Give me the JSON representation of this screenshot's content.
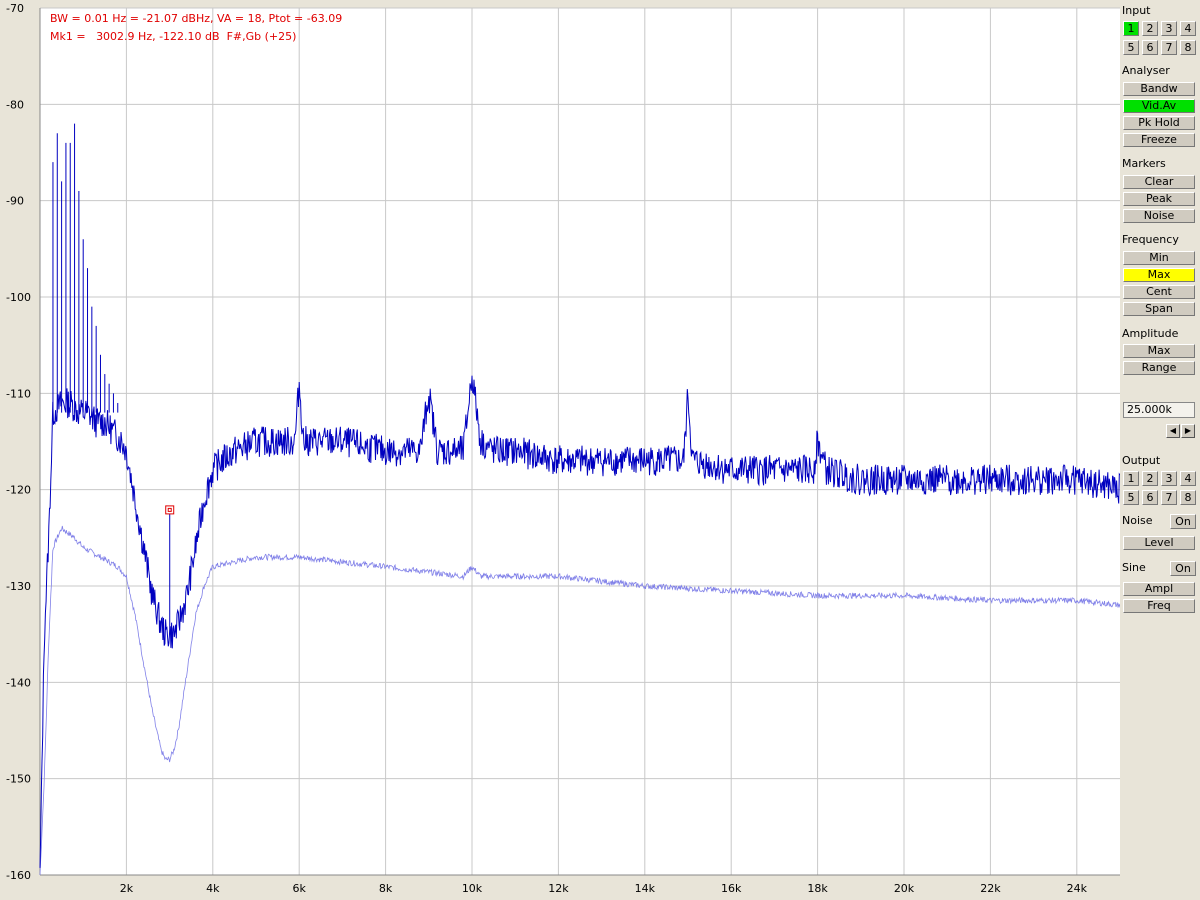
{
  "readout": {
    "line1": "BW = 0.01 Hz = -21.07 dBHz, VA = 18, Ptot = -63.09",
    "line2": "Mk1 =   3002.9 Hz, -122.10 dB  F#,Gb (+25)"
  },
  "colors": {
    "plot_bg": "#ffffff",
    "grid": "#c8c8c8",
    "trace_main": "#0000c0",
    "trace_secondary": "#8080e8",
    "marker": "#e00000",
    "active_green": "#00e000",
    "active_yellow": "#ffff00",
    "panel_bg": "#e8e4d8"
  },
  "panel": {
    "input": {
      "label": "Input",
      "channels": [
        "1",
        "2",
        "3",
        "4",
        "5",
        "6",
        "7",
        "8"
      ],
      "active": "1"
    },
    "analyser": {
      "label": "Analyser",
      "buttons": [
        {
          "label": "Bandw",
          "state": "off"
        },
        {
          "label": "Vid.Av",
          "state": "green"
        },
        {
          "label": "Pk Hold",
          "state": "off"
        },
        {
          "label": "Freeze",
          "state": "off"
        }
      ]
    },
    "markers": {
      "label": "Markers",
      "buttons": [
        {
          "label": "Clear",
          "state": "off"
        },
        {
          "label": "Peak",
          "state": "off"
        },
        {
          "label": "Noise",
          "state": "off"
        }
      ]
    },
    "frequency": {
      "label": "Frequency",
      "buttons": [
        {
          "label": "Min",
          "state": "off"
        },
        {
          "label": "Max",
          "state": "yellow"
        },
        {
          "label": "Cent",
          "state": "off"
        },
        {
          "label": "Span",
          "state": "off"
        }
      ]
    },
    "amplitude": {
      "label": "Amplitude",
      "buttons": [
        {
          "label": "Max",
          "state": "off"
        },
        {
          "label": "Range",
          "state": "off"
        }
      ]
    },
    "value_field": "25.000k",
    "arrow_left_icon": "triangle-left-icon",
    "arrow_right_icon": "triangle-right-icon",
    "output": {
      "label": "Output",
      "channels": [
        "1",
        "2",
        "3",
        "4",
        "5",
        "6",
        "7",
        "8"
      ],
      "active": ""
    },
    "noise": {
      "label": "Noise",
      "toggle": "On",
      "button": "Level"
    },
    "sine": {
      "label": "Sine",
      "toggle": "On",
      "buttons": [
        "Ampl",
        "Freq"
      ]
    }
  },
  "chart_data": {
    "type": "line",
    "title": "",
    "xlabel": "",
    "ylabel": "",
    "xlim": [
      0,
      25000
    ],
    "ylim": [
      -160,
      -70
    ],
    "grid": true,
    "x_ticks": [
      2000,
      4000,
      6000,
      8000,
      10000,
      12000,
      14000,
      16000,
      18000,
      20000,
      22000,
      24000
    ],
    "x_tick_labels": [
      "2k",
      "4k",
      "6k",
      "8k",
      "10k",
      "12k",
      "14k",
      "16k",
      "18k",
      "20k",
      "22k",
      "24k"
    ],
    "y_ticks": [
      -70,
      -80,
      -90,
      -100,
      -110,
      -120,
      -130,
      -140,
      -150,
      -160
    ],
    "y_tick_labels": [
      "-70",
      "-80",
      "-90",
      "-100",
      "-110",
      "-120",
      "-130",
      "-140",
      "-150",
      "-160"
    ],
    "series": [
      {
        "role": "main",
        "x": [
          0,
          100,
          200,
          300,
          500,
          700,
          900,
          1100,
          1300,
          1500,
          1700,
          1900,
          2000,
          2200,
          2400,
          2600,
          2800,
          2900,
          3000,
          3100,
          3200,
          3400,
          3600,
          3800,
          4000,
          4200,
          4500,
          5000,
          5500,
          5900,
          6000,
          6100,
          6500,
          7000,
          8000,
          8800,
          9000,
          9200,
          9800,
          10000,
          10200,
          10500,
          11000,
          12000,
          13000,
          14000,
          14900,
          15000,
          15100,
          16000,
          17000,
          17900,
          18000,
          18200,
          19000,
          20000,
          21000,
          22000,
          23000,
          24000,
          25000
        ],
        "y": [
          -160,
          -135,
          -125,
          -112,
          -111,
          -111,
          -112,
          -112,
          -113,
          -113,
          -114,
          -115,
          -116,
          -121,
          -126,
          -131,
          -134,
          -135,
          -135,
          -135,
          -134,
          -131,
          -126,
          -121,
          -118,
          -117,
          -116,
          -115,
          -115,
          -115,
          -109,
          -115,
          -115,
          -115,
          -116,
          -116,
          -110,
          -116,
          -116,
          -108,
          -115,
          -116,
          -116,
          -117,
          -117,
          -117,
          -117,
          -110,
          -117,
          -118,
          -118,
          -118,
          -115,
          -118,
          -119,
          -119,
          -119,
          -119,
          -119,
          -119,
          -120
        ]
      },
      {
        "role": "secondary",
        "x": [
          0,
          100,
          200,
          300,
          500,
          800,
          1000,
          1400,
          1800,
          2000,
          2200,
          2400,
          2600,
          2800,
          2900,
          3000,
          3100,
          3200,
          3400,
          3600,
          3800,
          4000,
          4500,
          5000,
          6000,
          8000,
          9800,
          10000,
          10200,
          12000,
          14000,
          16000,
          18000,
          20000,
          22000,
          24000,
          25000
        ],
        "y": [
          -160,
          -150,
          -136,
          -126,
          -124,
          -125,
          -126,
          -127,
          -128,
          -129,
          -133,
          -138,
          -143,
          -147,
          -148,
          -148,
          -147,
          -145,
          -139,
          -133,
          -130,
          -128,
          -127.5,
          -127,
          -127,
          -128,
          -129,
          -128,
          -129,
          -129,
          -130,
          -130.5,
          -131,
          -131,
          -131.5,
          -131.5,
          -132
        ]
      }
    ],
    "annotations": [
      {
        "type": "marker",
        "label": "Mk1",
        "x": 3002.9,
        "y": -122.1
      }
    ]
  }
}
